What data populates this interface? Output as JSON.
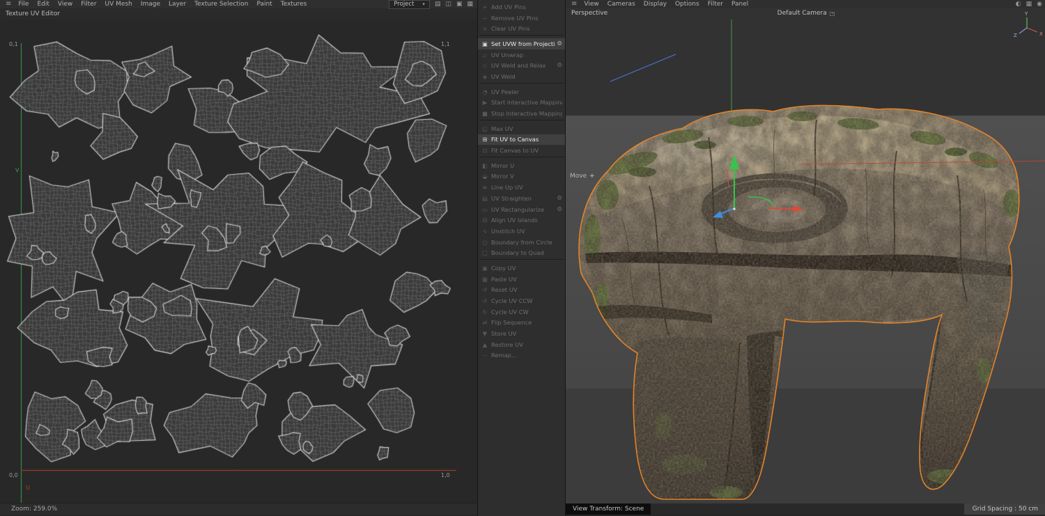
{
  "uv_editor": {
    "hamburger_glyph": "≡",
    "menu_items": [
      "File",
      "Edit",
      "View",
      "Filter",
      "UV Mesh",
      "Image",
      "Layer",
      "Texture Selection",
      "Paint",
      "Textures"
    ],
    "project_label": "Project",
    "dropdown_glyph": "▾",
    "right_icons": [
      {
        "name": "histogram-icon",
        "glyph": "▤"
      },
      {
        "name": "compare-icon",
        "glyph": "◫"
      },
      {
        "name": "lock-icon",
        "glyph": "▣"
      },
      {
        "name": "grid-icon",
        "glyph": "▦"
      }
    ],
    "panel_title": "Texture UV Editor",
    "corner_labels": {
      "tl": "0,1",
      "tr": "1,1",
      "bl": "0,0",
      "br": "1,0"
    },
    "axis_labels": {
      "u": "U",
      "v": "V"
    },
    "zoom_status": "Zoom: 259.0%"
  },
  "uv_commands": {
    "groups": [
      [
        {
          "label": "Add UV Pins",
          "icon": "add-uv-pins-icon",
          "glyph": "+",
          "enabled": false
        },
        {
          "label": "Remove UV Pins",
          "icon": "remove-uv-pins-icon",
          "glyph": "−",
          "enabled": false
        },
        {
          "label": "Clear UV Pins",
          "icon": "clear-uv-pins-icon",
          "glyph": "×",
          "enabled": false
        }
      ],
      [
        {
          "label": "Set UVW from Projection",
          "icon": "set-uvw-projection-icon",
          "glyph": "▣",
          "enabled": true,
          "selected": true,
          "gear": true
        },
        {
          "label": "UV Unwrap",
          "icon": "uv-unwrap-icon",
          "glyph": "▱",
          "enabled": false
        },
        {
          "label": "UV Weld and Relax",
          "icon": "uv-weld-relax-icon",
          "glyph": "◇",
          "enabled": false,
          "gear": true
        },
        {
          "label": "UV Weld",
          "icon": "uv-weld-icon",
          "glyph": "◈",
          "enabled": false
        }
      ],
      [
        {
          "label": "UV Peeler",
          "icon": "uv-peeler-icon",
          "glyph": "◔",
          "enabled": false
        },
        {
          "label": "Start Interactive Mapping",
          "icon": "start-interactive-mapping-icon",
          "glyph": "▶",
          "enabled": false
        },
        {
          "label": "Stop Interactive Mapping",
          "icon": "stop-interactive-mapping-icon",
          "glyph": "■",
          "enabled": false
        }
      ],
      [
        {
          "label": "Max UV",
          "icon": "max-uv-icon",
          "glyph": "◱",
          "enabled": false
        },
        {
          "label": "Fit UV to Canvas",
          "icon": "fit-uv-to-canvas-icon",
          "glyph": "⊞",
          "enabled": true,
          "selected": true
        },
        {
          "label": "Fit Canvas to UV",
          "icon": "fit-canvas-to-uv-icon",
          "glyph": "⊡",
          "enabled": false
        }
      ],
      [
        {
          "label": "Mirror U",
          "icon": "mirror-u-icon",
          "glyph": "◧",
          "enabled": false
        },
        {
          "label": "Mirror V",
          "icon": "mirror-v-icon",
          "glyph": "◒",
          "enabled": false
        },
        {
          "label": "Line Up UV",
          "icon": "line-up-uv-icon",
          "glyph": "≡",
          "enabled": false
        },
        {
          "label": "UV Straighten",
          "icon": "uv-straighten-icon",
          "glyph": "▤",
          "enabled": false,
          "gear": true
        },
        {
          "label": "UV Rectangularize",
          "icon": "uv-rectangularize-icon",
          "glyph": "▭",
          "enabled": false,
          "gear": true
        },
        {
          "label": "Align UV Islands",
          "icon": "align-uv-islands-icon",
          "glyph": "⊟",
          "enabled": false
        },
        {
          "label": "Unstitch UV",
          "icon": "unstitch-uv-icon",
          "glyph": "∿",
          "enabled": false
        },
        {
          "label": "Boundary from Circle",
          "icon": "boundary-from-circle-icon",
          "glyph": "○",
          "enabled": false
        },
        {
          "label": "Boundary to Quad",
          "icon": "boundary-to-quad-icon",
          "glyph": "□",
          "enabled": false
        }
      ],
      [
        {
          "label": "Copy UV",
          "icon": "copy-uv-icon",
          "glyph": "▣",
          "enabled": false
        },
        {
          "label": "Paste UV",
          "icon": "paste-uv-icon",
          "glyph": "▦",
          "enabled": false
        },
        {
          "label": "Reset UV",
          "icon": "reset-uv-icon",
          "glyph": "↺",
          "enabled": false
        },
        {
          "label": "Cycle UV CCW",
          "icon": "cycle-uv-ccw-icon",
          "glyph": "↺",
          "enabled": false
        },
        {
          "label": "Cycle UV CW",
          "icon": "cycle-uv-cw-icon",
          "glyph": "↻",
          "enabled": false
        },
        {
          "label": "Flip Sequence",
          "icon": "flip-sequence-icon",
          "glyph": "⇄",
          "enabled": false
        },
        {
          "label": "Store UV",
          "icon": "store-uv-icon",
          "glyph": "▼",
          "enabled": false
        },
        {
          "label": "Restore UV",
          "icon": "restore-uv-icon",
          "glyph": "▲",
          "enabled": false
        },
        {
          "label": "Remap...",
          "icon": "remap-icon",
          "glyph": "⋯",
          "enabled": false
        }
      ]
    ]
  },
  "viewport": {
    "hamburger_glyph": "≡",
    "menu_items": [
      "View",
      "Cameras",
      "Display",
      "Options",
      "Filter",
      "Panel"
    ],
    "right_icons": [
      {
        "name": "shading-icon",
        "glyph": "◐"
      },
      {
        "name": "grid-icon",
        "glyph": "▦"
      },
      {
        "name": "target-icon",
        "glyph": "◉"
      }
    ],
    "view_label": "Perspective",
    "camera_label": "Default Camera",
    "camera_icon_glyph": "◳",
    "tool_label": "Move",
    "tool_cursor_glyph": "+",
    "axis_gizmo": {
      "x": "X",
      "y": "Y",
      "z": "Z"
    },
    "footer": {
      "view_transform": "View Transform: Scene",
      "grid_spacing": "Grid Spacing : 50 cm"
    }
  },
  "colors": {
    "selection_outline": "#e2832a",
    "axis_u_red": "#c0392b",
    "axis_v_green": "#3f9f4f",
    "gizmo_green": "#39c24d",
    "gizmo_red": "#e04838",
    "gizmo_blue": "#3f8fe0"
  }
}
